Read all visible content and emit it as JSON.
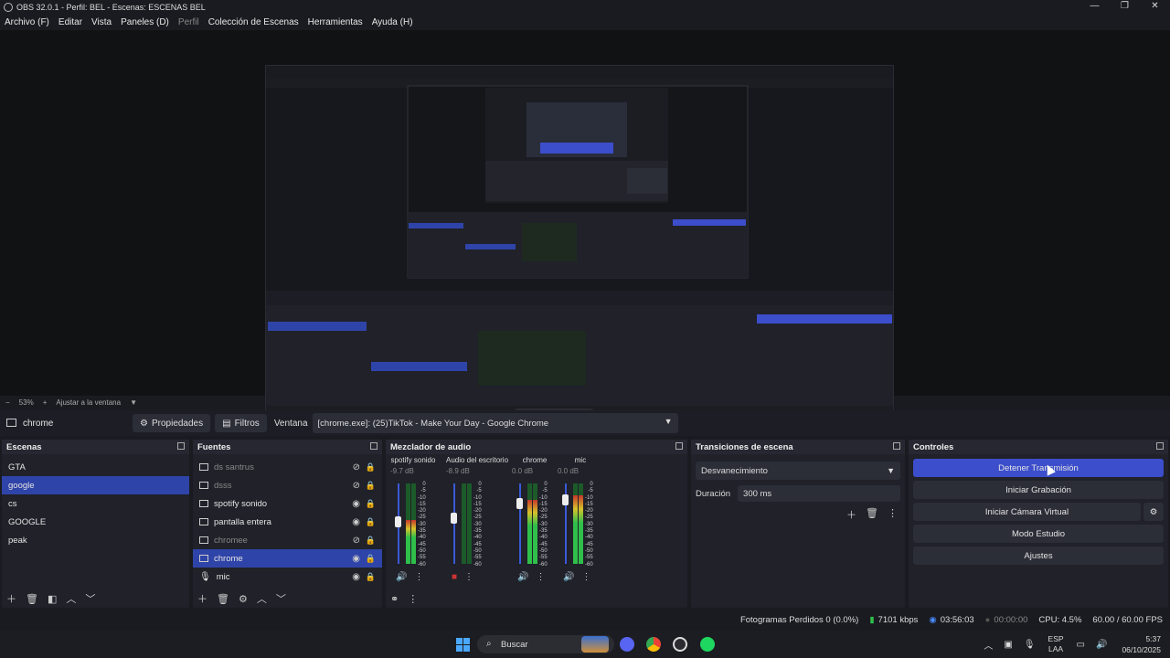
{
  "window": {
    "title": "OBS 32.0.1 - Perfil: BEL - Escenas: ESCENAS BEL",
    "controls": [
      "—",
      "❐",
      "✕"
    ]
  },
  "menu": [
    "Archivo (F)",
    "Editar",
    "Vista",
    "Paneles (D)",
    "Perfil",
    "Colección de Escenas",
    "Herramientas",
    "Ayuda (H)"
  ],
  "zoom": {
    "minus": "−",
    "level": "53%",
    "plus": "+",
    "fit": "Ajustar a la ventana"
  },
  "source_bar": {
    "name": "chrome",
    "properties": "Propiedades",
    "filters": "Filtros",
    "window_label": "Ventana",
    "window_value": "[chrome.exe]: (25)TikTok - Make Your Day - Google Chrome"
  },
  "scenes": {
    "title": "Escenas",
    "items": [
      "GTA",
      "google",
      "cs",
      "GOOGLE",
      "peak"
    ],
    "selected": "google"
  },
  "sources": {
    "title": "Fuentes",
    "items": [
      {
        "label": "ds santrus",
        "hidden": true
      },
      {
        "label": "dsss",
        "hidden": true
      },
      {
        "label": "spotify sonido",
        "hidden": false
      },
      {
        "label": "pantalla entera",
        "hidden": false
      },
      {
        "label": "chromee",
        "hidden": true
      },
      {
        "label": "chrome",
        "hidden": false,
        "selected": true
      },
      {
        "label": "mic",
        "hidden": false
      }
    ]
  },
  "mixer": {
    "title": "Mezclador de audio",
    "channels": [
      {
        "name": "spotify sonido",
        "db": "-9.7 dB",
        "level": 0.55,
        "muted": false
      },
      {
        "name": "Audio del escritorio",
        "db": "-8.9 dB",
        "level": 0.6,
        "muted": true
      },
      {
        "name": "chrome",
        "db": "0.0 dB",
        "level": 0.8,
        "muted": false
      },
      {
        "name": "mic",
        "db": "0.0 dB",
        "level": 0.85,
        "muted": false
      }
    ],
    "scale": [
      "0",
      "-5",
      "-10",
      "-15",
      "-20",
      "-25",
      "-30",
      "-35",
      "-40",
      "-45",
      "-50",
      "-55",
      "-60"
    ]
  },
  "transitions": {
    "title": "Transiciones de escena",
    "selected": "Desvanecimiento",
    "duration_label": "Duración",
    "duration_value": "300 ms"
  },
  "controls": {
    "title": "Controles",
    "stop_stream": "Detener Transmisión",
    "start_recording": "Iniciar Grabación",
    "start_virtual_cam": "Iniciar Cámara Virtual",
    "studio_mode": "Modo Estudio",
    "settings": "Ajustes"
  },
  "status": {
    "dropped_frames": "Fotogramas Perdidos 0 (0.0%)",
    "bitrate": "7101 kbps",
    "stream_time": "03:56:03",
    "rec_time": "00:00:00",
    "cpu": "CPU: 4.5%",
    "fps": "60.00 / 60.00 FPS"
  },
  "taskbar": {
    "search": "Buscar",
    "lang_top": "ESP",
    "lang_bottom": "LAA",
    "time": "5:37",
    "date": "06/10/2025"
  },
  "colors": {
    "accent": "#3c4ecb",
    "selection": "#2f44a8",
    "panel": "#202129",
    "background": "#1a1b21"
  }
}
